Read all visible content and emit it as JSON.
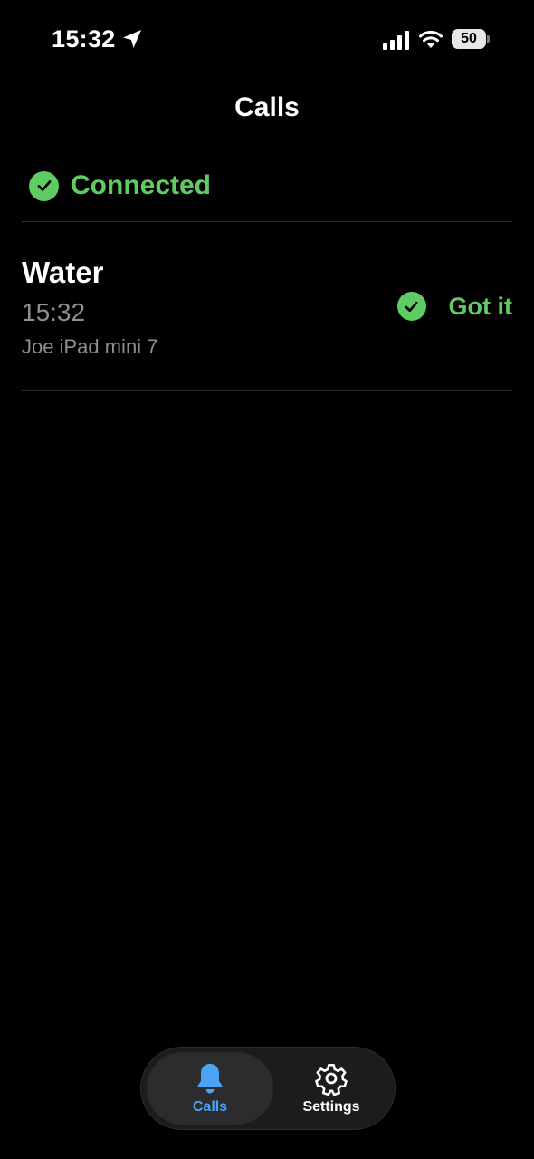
{
  "status_bar": {
    "time": "15:32",
    "battery": "50"
  },
  "header": {
    "title": "Calls"
  },
  "connection": {
    "label": "Connected",
    "color": "#5ecb63"
  },
  "calls": [
    {
      "name": "Water",
      "time": "15:32",
      "device": "Joe iPad mini 7",
      "ack_label": "Got it"
    }
  ],
  "tab_bar": {
    "tabs": [
      {
        "label": "Calls",
        "icon": "bell-icon",
        "active": true,
        "color": "#4aa3f5"
      },
      {
        "label": "Settings",
        "icon": "gear-icon",
        "active": false,
        "color": "#ffffff"
      }
    ]
  }
}
